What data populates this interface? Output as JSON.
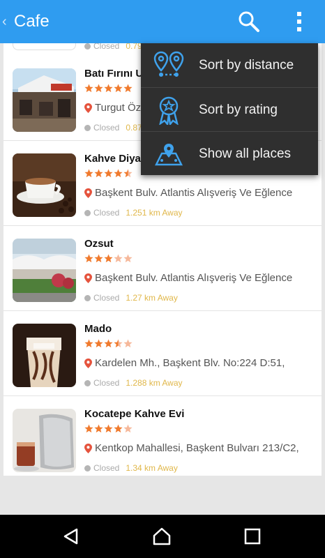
{
  "appbar": {
    "back_icon": "‹",
    "title": "Cafe",
    "search_icon": "search-icon",
    "overflow_icon": "more-vert-icon"
  },
  "colors": {
    "accent": "#2f9cf0",
    "star": "#f07a2d",
    "star_empty": "#f6b89a",
    "pin": "#e5533d",
    "distance": "#e0b74a"
  },
  "top_partial": {
    "status": "Closed",
    "distance": "0.79"
  },
  "places": [
    {
      "name": "Batı Fırını U",
      "rating": 5,
      "address": "Turgut Öz",
      "status": "Closed",
      "distance": "0.87"
    },
    {
      "name": "Kahve Diyar",
      "rating": 4.5,
      "address": "Başkent Bulv. Atlantis Alışveriş Ve Eğlence",
      "status": "Closed",
      "distance": "1.251 km Away"
    },
    {
      "name": "Ozsut",
      "rating": 3,
      "address": "Başkent Bulv. Atlantis Alışveriş Ve Eğlence",
      "status": "Closed",
      "distance": "1.27 km Away"
    },
    {
      "name": "Mado",
      "rating": 3.5,
      "address": "Kardelen Mh., Başkent Blv. No:224 D:51,",
      "status": "Closed",
      "distance": "1.288 km Away"
    },
    {
      "name": "Kocatepe Kahve Evi",
      "rating": 4,
      "address": "Kentkop Mahallesi, Başkent Bulvarı 213/C2,",
      "status": "Closed",
      "distance": "1.34 km Away"
    }
  ],
  "menu": {
    "items": [
      {
        "label": "Sort by distance",
        "icon": "map-pins-icon"
      },
      {
        "label": "Sort by rating",
        "icon": "award-ribbon-icon"
      },
      {
        "label": "Show all places",
        "icon": "map-icon"
      }
    ]
  },
  "navbar": {
    "back_icon": "nav-back-icon",
    "home_icon": "nav-home-icon",
    "recents_icon": "nav-recents-icon"
  }
}
